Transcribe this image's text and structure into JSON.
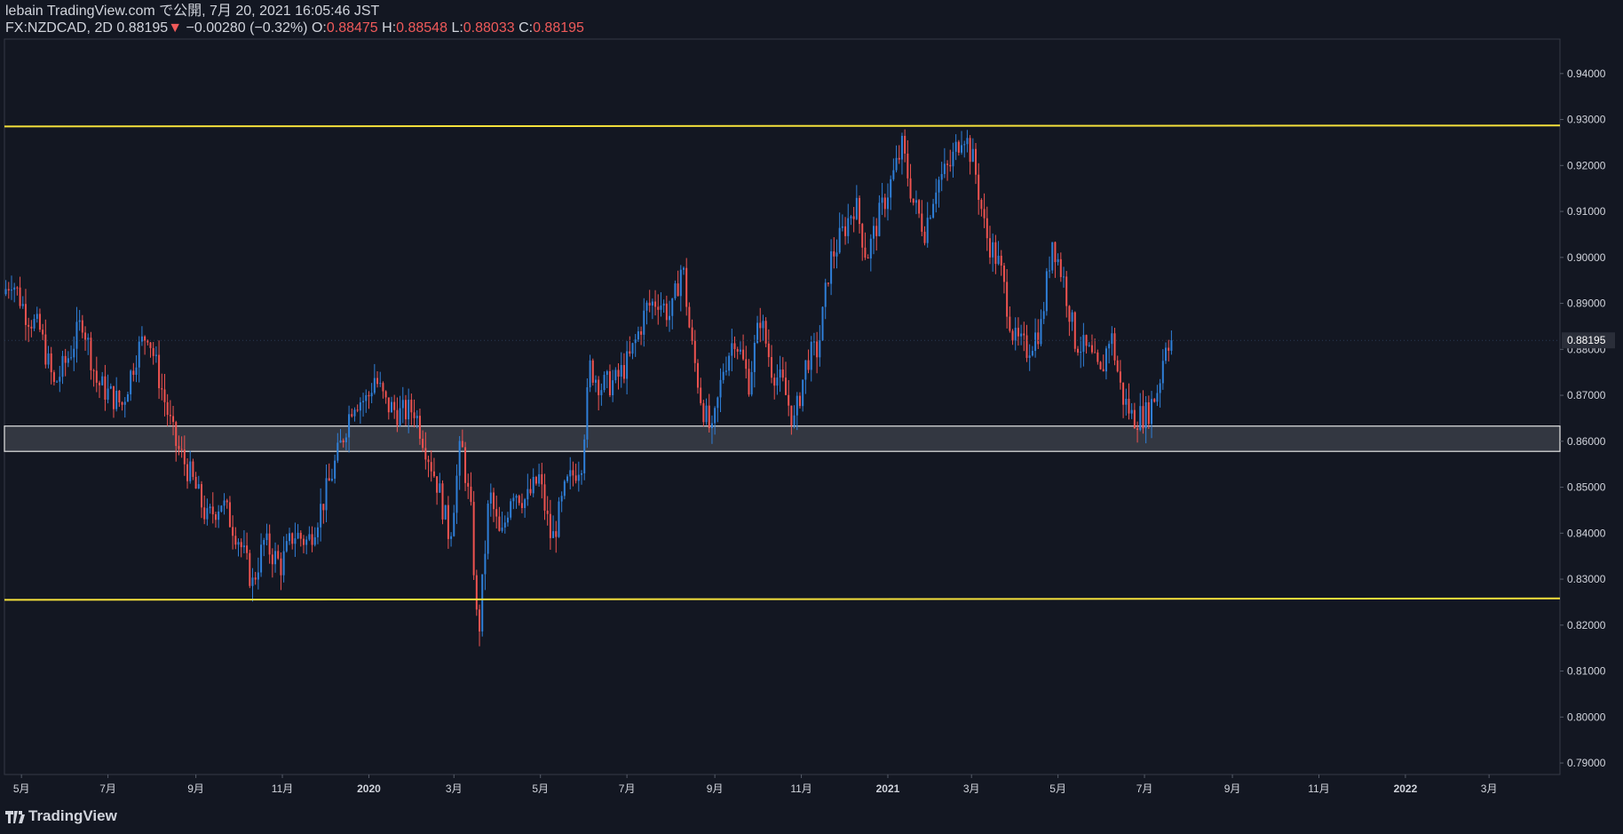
{
  "header": {
    "publisher": "lebain TradingView.com で公開, 7月 20, 2021 16:05:46 JST",
    "symbol": "FX:NZDCAD, 2D",
    "last": "0.88195",
    "change_arrow": "▼",
    "change": "−0.00280 (−0.32%)",
    "o_label": "O:",
    "o_value": "0.88475",
    "h_label": "H:",
    "h_value": "0.88548",
    "l_label": "L:",
    "l_value": "0.88033",
    "c_label": "C:",
    "c_value": "0.88195"
  },
  "footer": {
    "brand": "TradingView",
    "logo_icon": "tradingview-logo-icon"
  },
  "colors": {
    "background": "#131722",
    "up": "#2f7fd8",
    "down": "#ef5350",
    "level_line": "#f5e13c",
    "zone_fill": "#3a3d46",
    "zone_border": "#e6e6e6",
    "axis_text": "#d1d4dc",
    "price_tag_bg": "#2a2e39"
  },
  "chart_data": {
    "type": "candlestick",
    "symbol": "FX:NZDCAD",
    "interval": "2D",
    "last_price_label": "0.88195",
    "ylim": [
      0.7875,
      0.9475
    ],
    "y_ticks": [
      "0.79000",
      "0.80000",
      "0.81000",
      "0.82000",
      "0.83000",
      "0.84000",
      "0.85000",
      "0.86000",
      "0.87000",
      "0.88000",
      "0.89000",
      "0.90000",
      "0.91000",
      "0.92000",
      "0.93000",
      "0.94000"
    ],
    "x_ticks": [
      {
        "date": "2019-05-01",
        "label": "5月"
      },
      {
        "date": "2019-07-01",
        "label": "7月"
      },
      {
        "date": "2019-09-01",
        "label": "9月"
      },
      {
        "date": "2019-11-01",
        "label": "11月"
      },
      {
        "date": "2020-01-01",
        "label": "2020"
      },
      {
        "date": "2020-03-01",
        "label": "3月"
      },
      {
        "date": "2020-05-01",
        "label": "5月"
      },
      {
        "date": "2020-07-01",
        "label": "7月"
      },
      {
        "date": "2020-09-01",
        "label": "9月"
      },
      {
        "date": "2020-11-01",
        "label": "11月"
      },
      {
        "date": "2021-01-01",
        "label": "2021"
      },
      {
        "date": "2021-03-01",
        "label": "3月"
      },
      {
        "date": "2021-05-01",
        "label": "5月"
      },
      {
        "date": "2021-07-01",
        "label": "7月"
      },
      {
        "date": "2021-09-01",
        "label": "9月"
      },
      {
        "date": "2021-11-01",
        "label": "11月"
      },
      {
        "date": "2022-01-01",
        "label": "2022"
      },
      {
        "date": "2022-03-01",
        "label": "3月"
      }
    ],
    "x_range": [
      "2019-04-19",
      "2022-04-20"
    ],
    "price_path": [
      [
        "2019-04-19",
        0.892
      ],
      [
        "2019-04-25",
        0.8955
      ],
      [
        "2019-05-05",
        0.888
      ],
      [
        "2019-05-15",
        0.884
      ],
      [
        "2019-05-25",
        0.872
      ],
      [
        "2019-06-05",
        0.879
      ],
      [
        "2019-06-14",
        0.8865
      ],
      [
        "2019-06-24",
        0.873
      ],
      [
        "2019-07-02",
        0.8705
      ],
      [
        "2019-07-12",
        0.868
      ],
      [
        "2019-07-22",
        0.879
      ],
      [
        "2019-07-30",
        0.884
      ],
      [
        "2019-08-10",
        0.87
      ],
      [
        "2019-08-18",
        0.86
      ],
      [
        "2019-08-30",
        0.852
      ],
      [
        "2019-09-10",
        0.843
      ],
      [
        "2019-09-20",
        0.847
      ],
      [
        "2019-10-02",
        0.839
      ],
      [
        "2019-10-12",
        0.829
      ],
      [
        "2019-10-20",
        0.838
      ],
      [
        "2019-11-01",
        0.833
      ],
      [
        "2019-11-10",
        0.84
      ],
      [
        "2019-11-20",
        0.838
      ],
      [
        "2019-12-01",
        0.847
      ],
      [
        "2019-12-12",
        0.858
      ],
      [
        "2019-12-22",
        0.869
      ],
      [
        "2020-01-01",
        0.869
      ],
      [
        "2020-01-06",
        0.874
      ],
      [
        "2020-01-14",
        0.868
      ],
      [
        "2020-01-24",
        0.866
      ],
      [
        "2020-02-03",
        0.867
      ],
      [
        "2020-02-10",
        0.86
      ],
      [
        "2020-02-20",
        0.85
      ],
      [
        "2020-02-28",
        0.839
      ],
      [
        "2020-03-07",
        0.86
      ],
      [
        "2020-03-14",
        0.844
      ],
      [
        "2020-03-19",
        0.816
      ],
      [
        "2020-03-27",
        0.849
      ],
      [
        "2020-04-04",
        0.838
      ],
      [
        "2020-04-12",
        0.85
      ],
      [
        "2020-04-22",
        0.847
      ],
      [
        "2020-05-01",
        0.852
      ],
      [
        "2020-05-10",
        0.838
      ],
      [
        "2020-05-20",
        0.85
      ],
      [
        "2020-05-31",
        0.856
      ],
      [
        "2020-06-06",
        0.876
      ],
      [
        "2020-06-14",
        0.872
      ],
      [
        "2020-06-24",
        0.873
      ],
      [
        "2020-07-04",
        0.878
      ],
      [
        "2020-07-16",
        0.889
      ],
      [
        "2020-07-24",
        0.891
      ],
      [
        "2020-08-02",
        0.887
      ],
      [
        "2020-08-10",
        0.899
      ],
      [
        "2020-08-16",
        0.882
      ],
      [
        "2020-08-24",
        0.868
      ],
      [
        "2020-08-31",
        0.861
      ],
      [
        "2020-09-08",
        0.876
      ],
      [
        "2020-09-16",
        0.883
      ],
      [
        "2020-09-26",
        0.873
      ],
      [
        "2020-10-04",
        0.887
      ],
      [
        "2020-10-12",
        0.876
      ],
      [
        "2020-10-20",
        0.872
      ],
      [
        "2020-10-28",
        0.864
      ],
      [
        "2020-11-06",
        0.878
      ],
      [
        "2020-11-14",
        0.88
      ],
      [
        "2020-11-22",
        0.899
      ],
      [
        "2020-12-02",
        0.906
      ],
      [
        "2020-12-10",
        0.912
      ],
      [
        "2020-12-18",
        0.9
      ],
      [
        "2020-12-28",
        0.91
      ],
      [
        "2021-01-06",
        0.918
      ],
      [
        "2021-01-12",
        0.924
      ],
      [
        "2021-01-20",
        0.912
      ],
      [
        "2021-01-28",
        0.906
      ],
      [
        "2021-02-05",
        0.916
      ],
      [
        "2021-02-15",
        0.92
      ],
      [
        "2021-02-24",
        0.928
      ],
      [
        "2021-03-04",
        0.92
      ],
      [
        "2021-03-12",
        0.905
      ],
      [
        "2021-03-22",
        0.898
      ],
      [
        "2021-04-01",
        0.882
      ],
      [
        "2021-04-10",
        0.88
      ],
      [
        "2021-04-20",
        0.885
      ],
      [
        "2021-04-28",
        0.904
      ],
      [
        "2021-05-06",
        0.895
      ],
      [
        "2021-05-14",
        0.882
      ],
      [
        "2021-05-24",
        0.879
      ],
      [
        "2021-06-01",
        0.874
      ],
      [
        "2021-06-08",
        0.884
      ],
      [
        "2021-06-16",
        0.87
      ],
      [
        "2021-06-24",
        0.865
      ],
      [
        "2021-07-04",
        0.866
      ],
      [
        "2021-07-12",
        0.872
      ],
      [
        "2021-07-17",
        0.882
      ],
      [
        "2021-07-20",
        0.882
      ]
    ],
    "annotations": {
      "resistance_line": {
        "price_start": 0.9285,
        "price_end": 0.9287,
        "color": "#f5e13c"
      },
      "support_line": {
        "price_start": 0.8255,
        "price_end": 0.8258,
        "color": "#f5e13c"
      },
      "zone": {
        "top": 0.8633,
        "bottom": 0.8578
      }
    },
    "grid": false,
    "legend": "none"
  }
}
